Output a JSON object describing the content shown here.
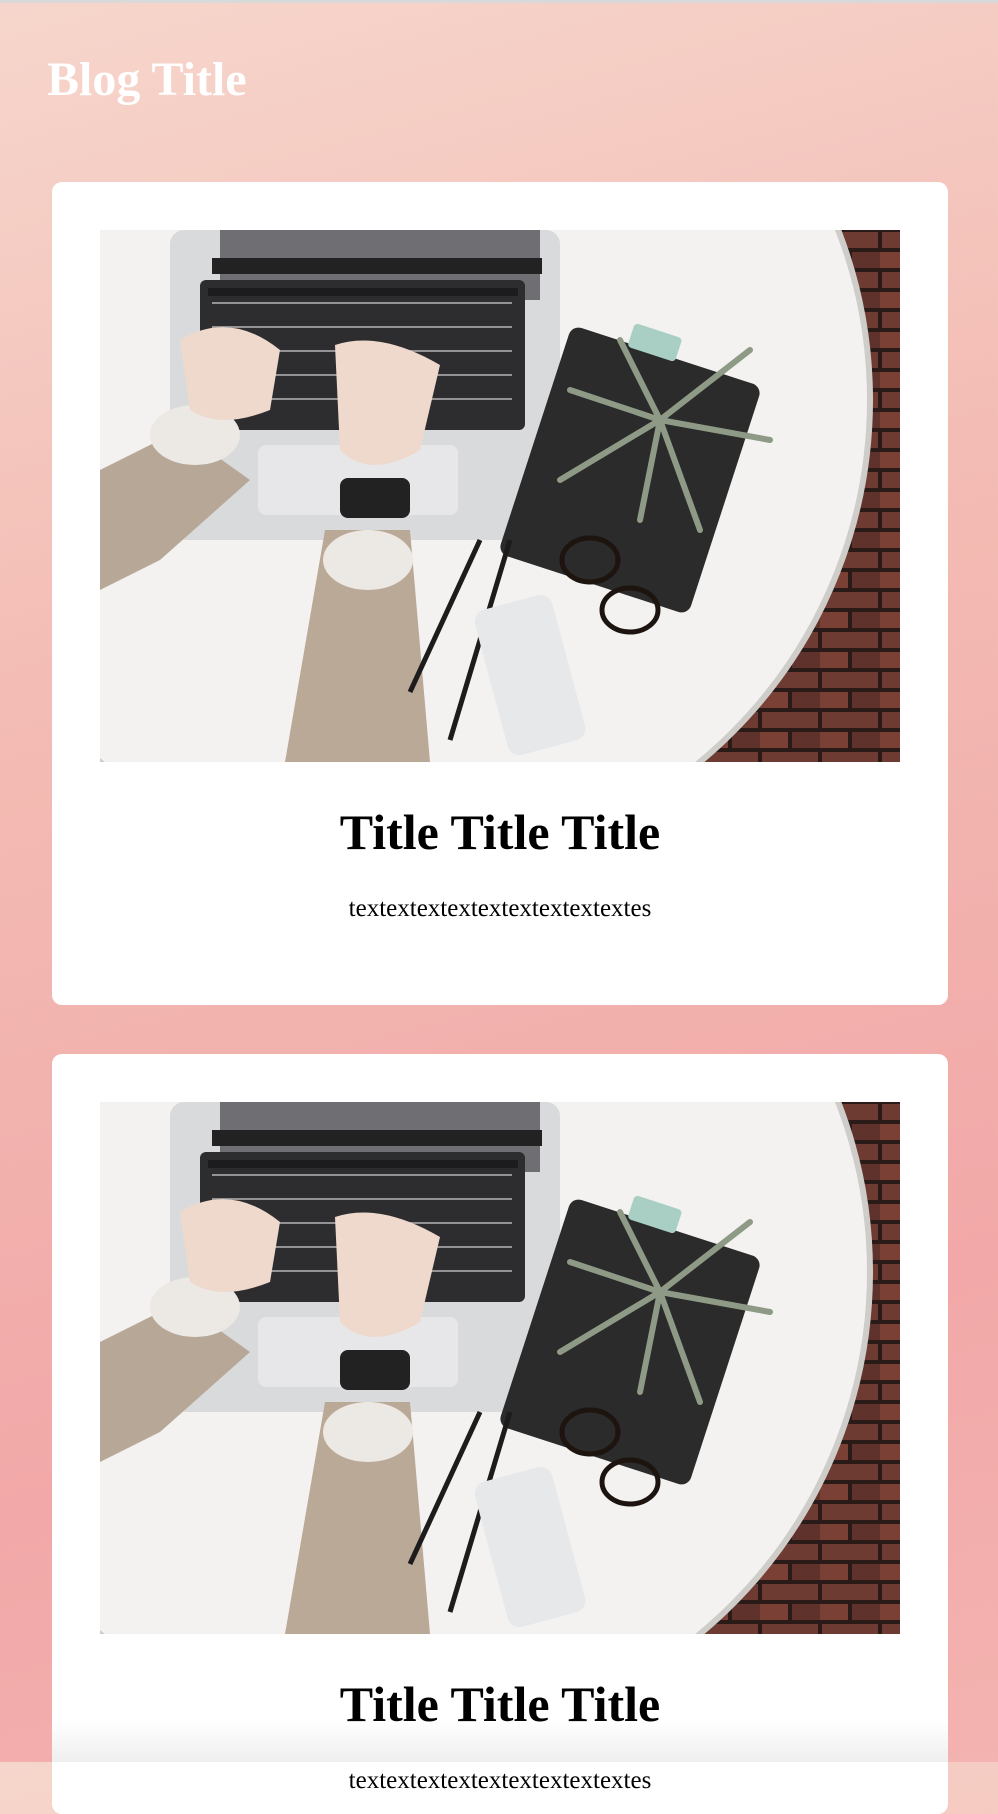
{
  "header": {
    "blog_title": "Blog Title"
  },
  "posts": [
    {
      "title": "Title Title Title",
      "text": "textextextextextextextextextes",
      "image_alt": "Hands typing on a laptop on a white round table with a plant, glasses, phone and pencils"
    },
    {
      "title": "Title Title Title",
      "text": "textextextextextextextextextes",
      "image_alt": "Hands typing on a laptop on a white round table with a plant, glasses, phone and pencils"
    }
  ],
  "colors": {
    "background_top": "#f6d6cc",
    "background_bottom": "#f2a8a8",
    "card": "#ffffff",
    "title_text": "#ffffff"
  }
}
